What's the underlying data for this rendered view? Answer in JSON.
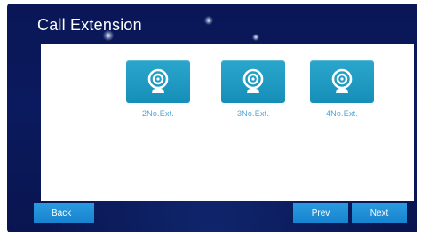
{
  "screen": {
    "title": "Call Extension"
  },
  "extensions": [
    {
      "label": "2No.Ext.",
      "icon": "webcam-icon"
    },
    {
      "label": "3No.Ext.",
      "icon": "webcam-icon"
    },
    {
      "label": "4No.Ext.",
      "icon": "webcam-icon"
    }
  ],
  "footer": {
    "back_label": "Back",
    "prev_label": "Prev",
    "next_label": "Next"
  },
  "colors": {
    "background": "#0b1a5e",
    "tile": "#1a95be",
    "button": "#1f8fd8",
    "label": "#4fa6d6"
  }
}
